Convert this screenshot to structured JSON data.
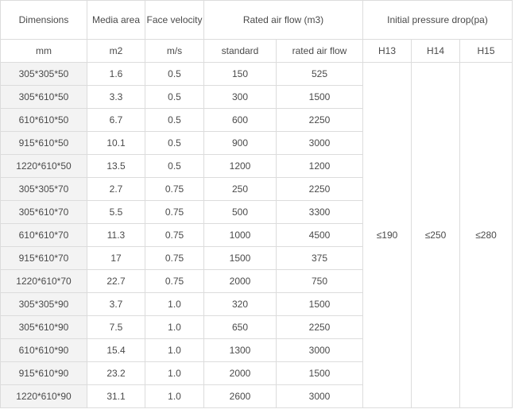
{
  "table": {
    "header_row_1": {
      "dimensions": "Dimensions",
      "media_area": "Media area",
      "face_velocity": "Face velocity",
      "rated_air_flow": "Rated air flow (m3)",
      "initial_pressure_drop": "Initial pressure drop(pa)"
    },
    "header_row_2": [
      "mm",
      "m2",
      "m/s",
      "standard",
      "rated air flow",
      "H13",
      "H14",
      "H15"
    ],
    "rows": [
      [
        "305*305*50",
        "1.6",
        "0.5",
        "150",
        "525"
      ],
      [
        "305*610*50",
        "3.3",
        "0.5",
        "300",
        "1500"
      ],
      [
        "610*610*50",
        "6.7",
        "0.5",
        "600",
        "2250"
      ],
      [
        "915*610*50",
        "10.1",
        "0.5",
        "900",
        "3000"
      ],
      [
        "1220*610*50",
        "13.5",
        "0.5",
        "1200",
        "1200"
      ],
      [
        "305*305*70",
        "2.7",
        "0.75",
        "250",
        "2250"
      ],
      [
        "305*610*70",
        "5.5",
        "0.75",
        "500",
        "3300"
      ],
      [
        "610*610*70",
        "11.3",
        "0.75",
        "1000",
        "4500"
      ],
      [
        "915*610*70",
        "17",
        "0.75",
        "1500",
        "375"
      ],
      [
        "1220*610*70",
        "22.7",
        "0.75",
        "2000",
        "750"
      ],
      [
        "305*305*90",
        "3.7",
        "1.0",
        "320",
        "1500"
      ],
      [
        "305*610*90",
        "7.5",
        "1.0",
        "650",
        "2250"
      ],
      [
        "610*610*90",
        "15.4",
        "1.0",
        "1300",
        "3000"
      ],
      [
        "915*610*90",
        "23.2",
        "1.0",
        "2000",
        "1500"
      ],
      [
        "1220*610*90",
        "31.1",
        "1.0",
        "2600",
        "3000"
      ]
    ],
    "pressure_drop": {
      "h13": "≤190",
      "h14": "≤250",
      "h15": "≤280"
    }
  }
}
